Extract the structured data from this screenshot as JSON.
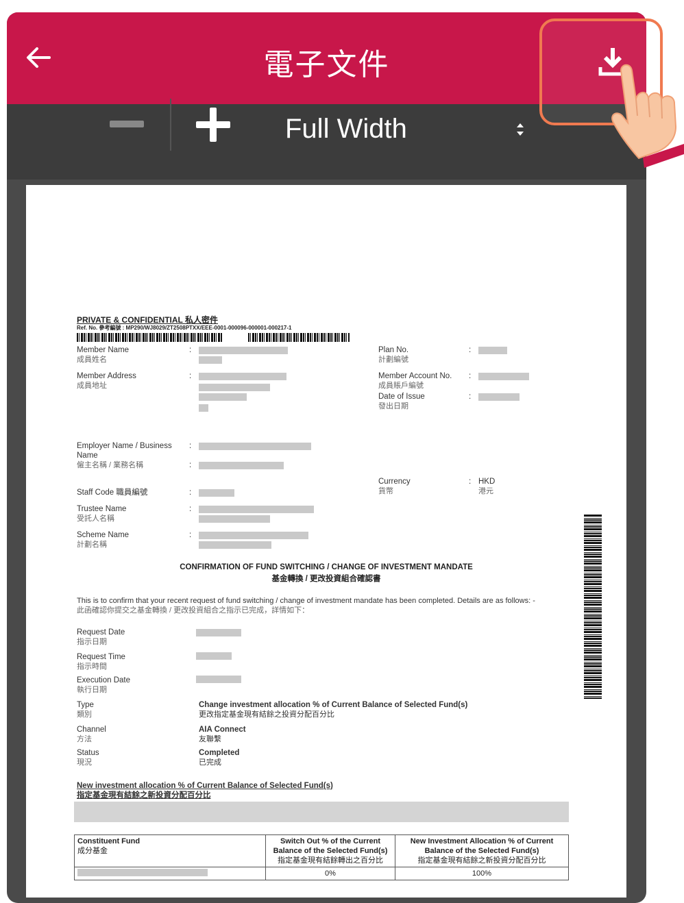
{
  "app": {
    "title": "電子文件",
    "zoom_label": "Full Width"
  },
  "icons": {
    "back": "arrow-left-icon",
    "download": "download-icon",
    "zoom_out": "minus-icon",
    "zoom_in": "plus-icon",
    "zoom_select": "updown-chevron-icon",
    "hand": "pointing-hand-icon"
  },
  "colors": {
    "appbar": "#c8174a",
    "toolbar": "#3c3c3c",
    "highlight": "#f07a50"
  },
  "document": {
    "confidential": "PRIVATE & CONFIDENTIAL 私人密件",
    "ref": "Ref. No. 參考編號 : MP290/WJ8029/ZT2508PTXX/EEE-0001-000096-000001-000217-1",
    "member_name": {
      "en": "Member Name",
      "zh": "成員姓名"
    },
    "member_address": {
      "en": "Member Address",
      "zh": "成員地址"
    },
    "plan_no": {
      "en": "Plan No.",
      "zh": "計劃編號"
    },
    "member_account": {
      "en": "Member Account No.",
      "zh": "成員賬戶編號"
    },
    "date_of_issue": {
      "en": "Date of Issue",
      "zh": "發出日期"
    },
    "employer_name": {
      "en": "Employer Name / Business",
      "en2": "Name",
      "zh": "僱主名稱 / 業務名稱"
    },
    "currency": {
      "en": "Currency",
      "zh": "貨幣",
      "value_en": "HKD",
      "value_zh": "港元"
    },
    "staff_code": {
      "label": "Staff Code 職員編號"
    },
    "trustee_name": {
      "en": "Trustee Name",
      "zh": "受託人名稱"
    },
    "scheme_name": {
      "en": "Scheme Name",
      "zh": "計劃名稱"
    },
    "colon": ":",
    "heading_en": "CONFIRMATION OF FUND SWITCHING / CHANGE OF INVESTMENT MANDATE",
    "heading_zh": "基金轉換 / 更改投資組合確認書",
    "intro_en": "This is to confirm that your recent request of fund switching / change of investment mandate has been completed. Details are as follows: -",
    "intro_zh": "此函確認你提交之基金轉換 / 更改投資組合之指示已完成，詳情如下：",
    "request_date": {
      "en": "Request Date",
      "zh": "指示日期"
    },
    "request_time": {
      "en": "Request Time",
      "zh": "指示時間"
    },
    "execution_date": {
      "en": "Execution Date",
      "zh": "執行日期"
    },
    "type": {
      "en": "Type",
      "zh": "類別",
      "value_en": "Change investment allocation % of Current Balance of Selected Fund(s)",
      "value_zh": "更改指定基金現有結餘之投資分配百分比"
    },
    "channel": {
      "en": "Channel",
      "zh": "方法",
      "value_en": "AIA Connect",
      "value_zh": "友聯繫"
    },
    "status": {
      "en": "Status",
      "zh": "現況",
      "value_en": "Completed",
      "value_zh": "已完成"
    },
    "alloc_heading_en": "New investment allocation % of Current Balance of Selected Fund(s)",
    "alloc_heading_zh": "指定基金現有結餘之新投資分配百分比",
    "table": {
      "col1_en": "Constituent Fund",
      "col1_zh": "成分基金",
      "col2_en": "Switch Out % of the Current Balance of the Selected Fund(s)",
      "col2_zh": "指定基金現有結餘轉出之百分比",
      "col3_en": "New Investment Allocation % of Current Balance of the Selected Fund(s)",
      "col3_zh": "指定基金現有結餘之新投資分配百分比",
      "row_switch": "0%",
      "row_alloc": "100%"
    }
  }
}
